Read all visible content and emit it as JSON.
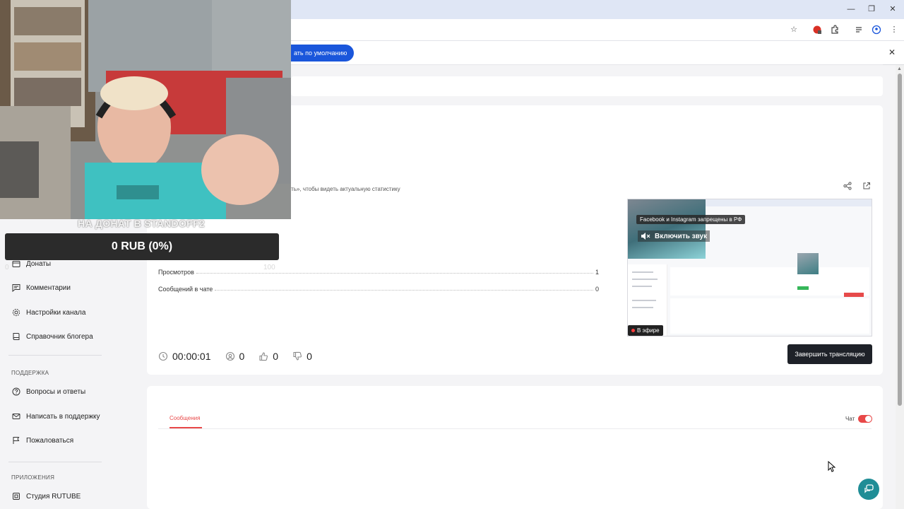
{
  "browser": {
    "infobar_button": "ать по умолчанию"
  },
  "overlay": {
    "donation_title": "НА ДОНАТ В STANDOFF2",
    "donation_amount": "0 RUB (0%)",
    "goal_max": "100",
    "goal_min": "0"
  },
  "sidebar": {
    "items": [
      {
        "label": "Донаты",
        "icon": "wallet-icon"
      },
      {
        "label": "Комментарии",
        "icon": "comment-icon"
      },
      {
        "label": "Настройки канала",
        "icon": "gear-icon"
      },
      {
        "label": "Справочник блогера",
        "icon": "book-icon"
      }
    ],
    "support_title": "ПОДДЕРЖКА",
    "support_items": [
      {
        "label": "Вопросы и ответы",
        "icon": "help-circle-icon"
      },
      {
        "label": "Написать в поддержку",
        "icon": "mail-icon"
      },
      {
        "label": "Пожаловаться",
        "icon": "flag-icon"
      }
    ],
    "apps_title": "ПРИЛОЖЕНИЯ",
    "apps_items": [
      {
        "label": "Студия RUTUBE",
        "icon": "studio-icon"
      }
    ]
  },
  "stats": {
    "notice": "бновить», чтобы видеть актуальную статистику",
    "rows": [
      {
        "label": "Просмотров",
        "value": "1"
      },
      {
        "label": "Сообщений в чате",
        "value": "0"
      }
    ],
    "timer": "00:00:01",
    "viewers": "0",
    "likes": "0",
    "dislikes": "0"
  },
  "preview": {
    "fb_badge": "Facebook и Instagram запрещены в РФ",
    "sound_label": "Включить звук",
    "onair_label": "В эфире"
  },
  "actions": {
    "end_stream": "Завершить трансляцию"
  },
  "chat": {
    "tab_messages": "Сообщения",
    "chat_label": "Чат",
    "chat_enabled": true
  },
  "colors": {
    "accent": "#e84848",
    "chrome_blue": "#1a56db",
    "fab": "#1f8d96",
    "dark_button": "#1e2128"
  }
}
